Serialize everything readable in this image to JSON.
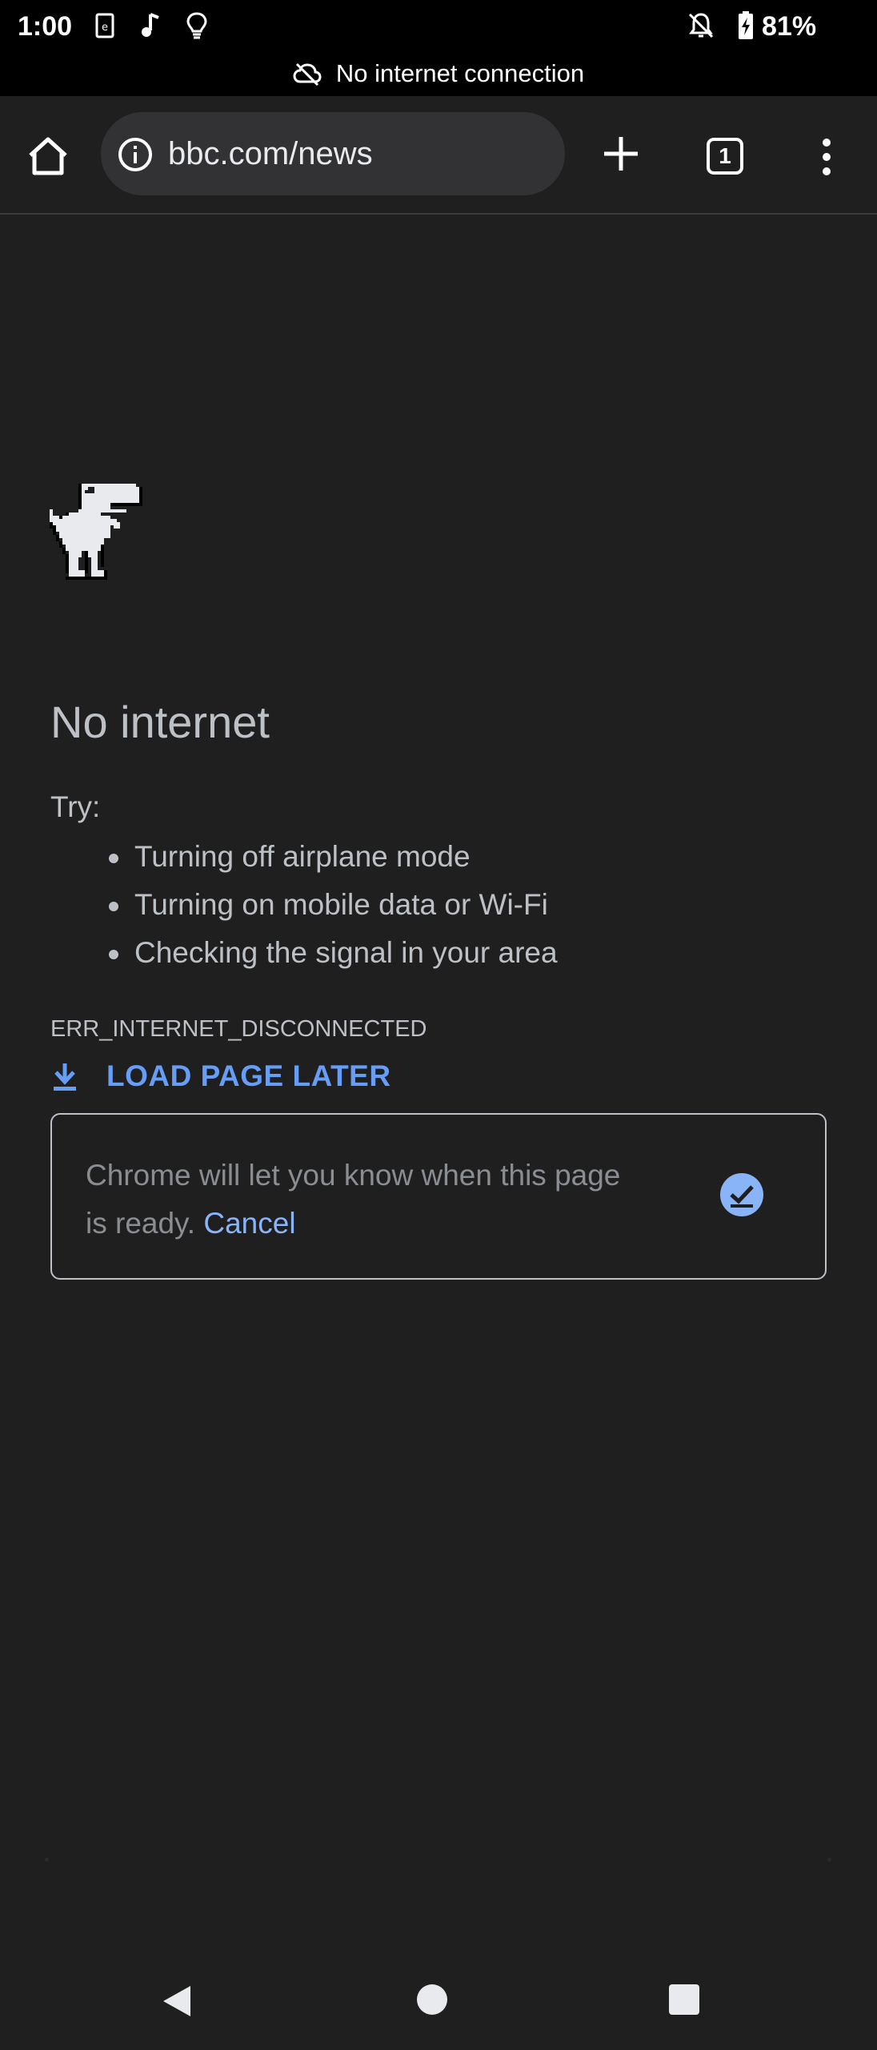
{
  "status_bar": {
    "time": "1:00",
    "battery": "81%",
    "icons": [
      "sim-card-icon",
      "music-note-icon",
      "lightbulb-icon",
      "notifications-off-icon",
      "battery-charging-icon"
    ]
  },
  "banner": {
    "text": "No internet connection",
    "icon": "cloud-off-icon"
  },
  "toolbar": {
    "url": "bbc.com/news",
    "tab_count": "1",
    "icons": [
      "home-icon",
      "info-icon",
      "plus-icon",
      "tab-switcher-icon",
      "more-vert-icon"
    ]
  },
  "error_page": {
    "illustration": "offline-dino-icon",
    "heading": "No internet",
    "try_label": "Try:",
    "suggestions": [
      "Turning off airplane mode",
      "Turning on mobile data or Wi-Fi",
      "Checking the signal in your area"
    ],
    "error_code": "ERR_INTERNET_DISCONNECTED",
    "load_later_label": "LOAD PAGE LATER",
    "notice_text": "Chrome will let you know when this page is ready.",
    "cancel_label": "Cancel"
  },
  "colors": {
    "background": "#1f1f20",
    "accent_blue": "#669df6",
    "link_blue": "#8ab4f8",
    "text_gray": "#bdc1c6"
  },
  "nav_bar": {
    "icons": [
      "back-icon",
      "home-circle-icon",
      "recents-icon"
    ]
  }
}
